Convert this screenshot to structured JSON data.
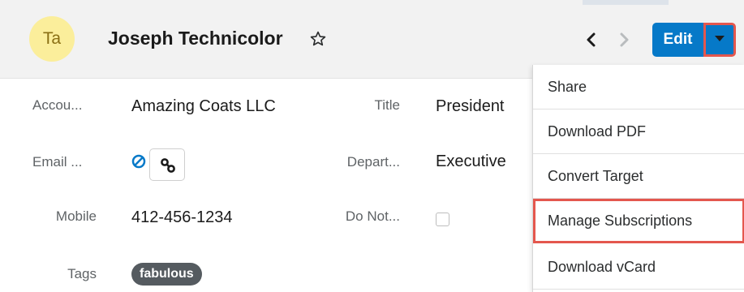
{
  "header": {
    "avatar_initials": "Ta",
    "record_name": "Joseph Technicolor",
    "edit_label": "Edit"
  },
  "fields": {
    "account": {
      "label": "Accou...",
      "value": "Amazing Coats LLC"
    },
    "title": {
      "label": "Title",
      "value": "President"
    },
    "email": {
      "label": "Email ..."
    },
    "department": {
      "label": "Depart...",
      "value": "Executive"
    },
    "mobile": {
      "label": "Mobile",
      "value": "412-456-1234"
    },
    "do_not_call": {
      "label": "Do Not...",
      "checked": false
    },
    "tags": {
      "label": "Tags",
      "values": [
        "fabulous"
      ]
    }
  },
  "actions_menu": {
    "items": [
      {
        "label": "Share"
      },
      {
        "label": "Download PDF"
      },
      {
        "label": "Convert Target"
      },
      {
        "label": "Manage Subscriptions",
        "highlighted": true
      },
      {
        "label": "Download vCard"
      }
    ]
  },
  "colors": {
    "primary": "#0679c8",
    "highlight_outline": "#e4574e",
    "avatar_bg": "#fbee9b",
    "tag_bg": "#555b60"
  },
  "icons": {
    "favorite": "star-outline-icon",
    "previous": "chevron-left-icon",
    "next": "chevron-right-icon",
    "actions": "caret-down-icon",
    "email_opt_out": "blocked-circle-icon",
    "link": "link-icon"
  }
}
